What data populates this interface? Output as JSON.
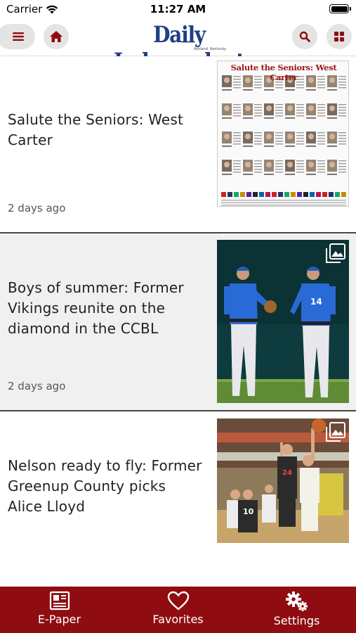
{
  "status_bar": {
    "carrier": "Carrier",
    "time": "11:27 AM"
  },
  "header": {
    "logo_text": "Daily Independent",
    "logo_sub": "Ashland, Kentucky"
  },
  "articles": [
    {
      "title": "Salute the Seniors: West Carter",
      "time_ago": "2 days ago",
      "thumb_headline": "Salute the Seniors: West Carter",
      "has_gallery": false
    },
    {
      "title": "Boys of summer: Former Vikings reunite on the diamond in the CCBL",
      "time_ago": "2 days ago",
      "has_gallery": true
    },
    {
      "title": "Nelson ready to fly: Former Greenup County picks Alice Lloyd",
      "has_gallery": true
    }
  ],
  "tabs": [
    {
      "label": "E-Paper",
      "icon": "newspaper-icon"
    },
    {
      "label": "Favorites",
      "icon": "heart-icon"
    },
    {
      "label": "Settings",
      "icon": "gears-icon"
    }
  ],
  "colors": {
    "brand_red": "#8f0d11",
    "logo_blue": "#1f3f86"
  }
}
